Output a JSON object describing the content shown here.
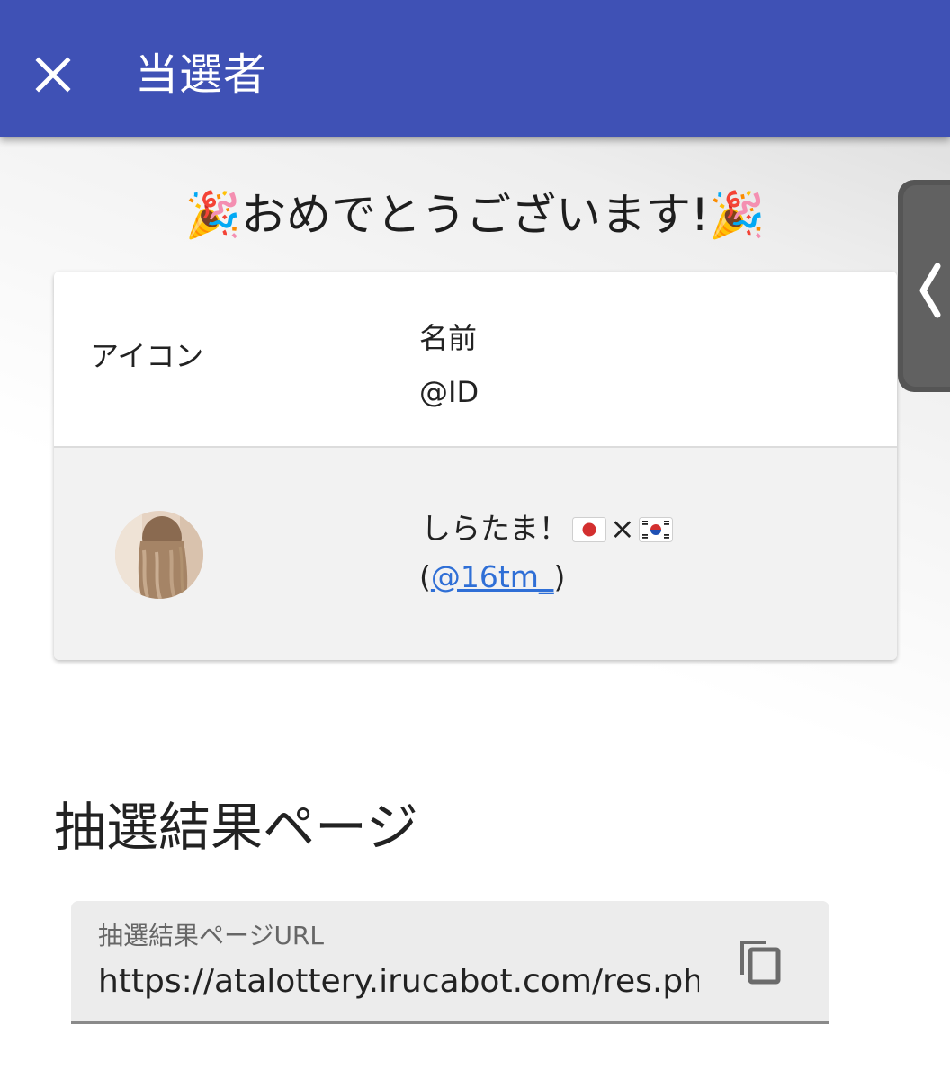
{
  "appbar": {
    "title": "当選者",
    "close_icon": "close-icon",
    "color": "#3f51b5"
  },
  "congrats": {
    "text": "おめでとうございます!",
    "emoji_left": "🎉",
    "emoji_right": "🎉"
  },
  "winners_table": {
    "headers": {
      "icon": "アイコン",
      "name": "名前",
      "id": "@ID"
    },
    "rows": [
      {
        "avatar_icon": "avatar",
        "name_text": "しらたま！",
        "flag_japan": "japan-flag-icon",
        "separator": "×",
        "flag_korea": "korea-flag-icon",
        "id_open": "(",
        "id_link": "@16tm_",
        "id_close": ")"
      }
    ]
  },
  "result_page": {
    "section_title": "抽選結果ページ",
    "url_label": "抽選結果ページURL",
    "url_value": "https://atalottery.irucabot.com/res.php",
    "copy_icon": "copy-icon"
  },
  "side_panel": {
    "chevron_icon": "chevron-left-icon"
  },
  "colors": {
    "link": "#2f6fd6",
    "row_bg": "#f2f2f2",
    "field_bg": "#ececec"
  }
}
